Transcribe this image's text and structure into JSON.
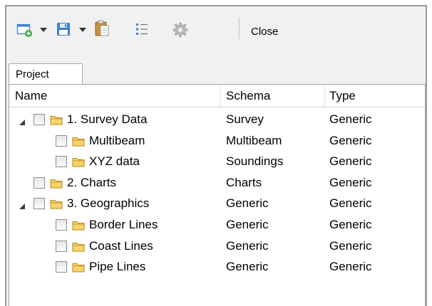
{
  "toolbar": {
    "buttons": [
      {
        "name": "new-icon"
      },
      {
        "name": "save-icon"
      },
      {
        "name": "paste-icon"
      },
      {
        "name": "list-icon"
      },
      {
        "name": "settings-icon"
      }
    ],
    "close_label": "Close"
  },
  "tab": {
    "label": "Project"
  },
  "table": {
    "columns": [
      "Name",
      "Schema",
      "Type"
    ],
    "rows": [
      {
        "name": "1. Survey Data",
        "schema": "Survey",
        "type": "Generic",
        "level": 0,
        "expanded": true
      },
      {
        "name": "Multibeam",
        "schema": "Multibeam",
        "type": "Generic",
        "level": 1
      },
      {
        "name": "XYZ data",
        "schema": "Soundings",
        "type": "Generic",
        "level": 1
      },
      {
        "name": "2. Charts",
        "schema": "Charts",
        "type": "Generic",
        "level": 0
      },
      {
        "name": "3. Geographics",
        "schema": "Generic",
        "type": "Generic",
        "level": 0,
        "expanded": true
      },
      {
        "name": "Border Lines",
        "schema": "Generic",
        "type": "Generic",
        "level": 1
      },
      {
        "name": "Coast Lines",
        "schema": "Generic",
        "type": "Generic",
        "level": 1
      },
      {
        "name": "Pipe Lines",
        "schema": "Generic",
        "type": "Generic",
        "level": 1
      }
    ]
  },
  "colors": {
    "folder_fill": "#f7d46b",
    "folder_stroke": "#b8861a",
    "icon_blue": "#3c7fd1",
    "icon_green": "#3fa83a"
  }
}
